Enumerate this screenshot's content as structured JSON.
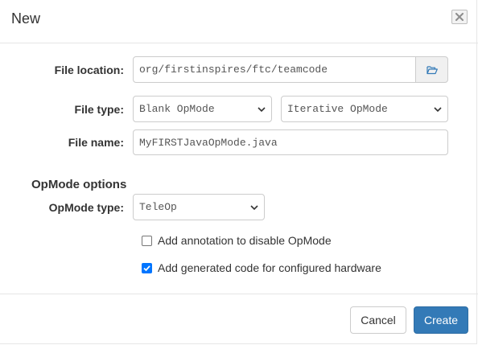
{
  "dialog": {
    "title": "New",
    "close_icon": "close-icon"
  },
  "form": {
    "file_location": {
      "label": "File location:",
      "value": "org/firstinspires/ftc/teamcode",
      "browse_icon": "folder-open-icon"
    },
    "file_type": {
      "label": "File type:",
      "template_select": {
        "selected": "Blank OpMode"
      },
      "kind_select": {
        "selected": "Iterative OpMode"
      }
    },
    "file_name": {
      "label": "File name:",
      "value": "MyFIRSTJavaOpMode.java"
    }
  },
  "opmode_options": {
    "heading": "OpMode options",
    "type": {
      "label": "OpMode type:",
      "selected": "TeleOp"
    },
    "checkboxes": [
      {
        "label": "Add annotation to disable OpMode",
        "checked": false
      },
      {
        "label": "Add generated code for configured hardware",
        "checked": true
      }
    ]
  },
  "footer": {
    "cancel_label": "Cancel",
    "create_label": "Create"
  },
  "colors": {
    "primary": "#337ab7",
    "checkbox_checked": "#0075ff"
  }
}
